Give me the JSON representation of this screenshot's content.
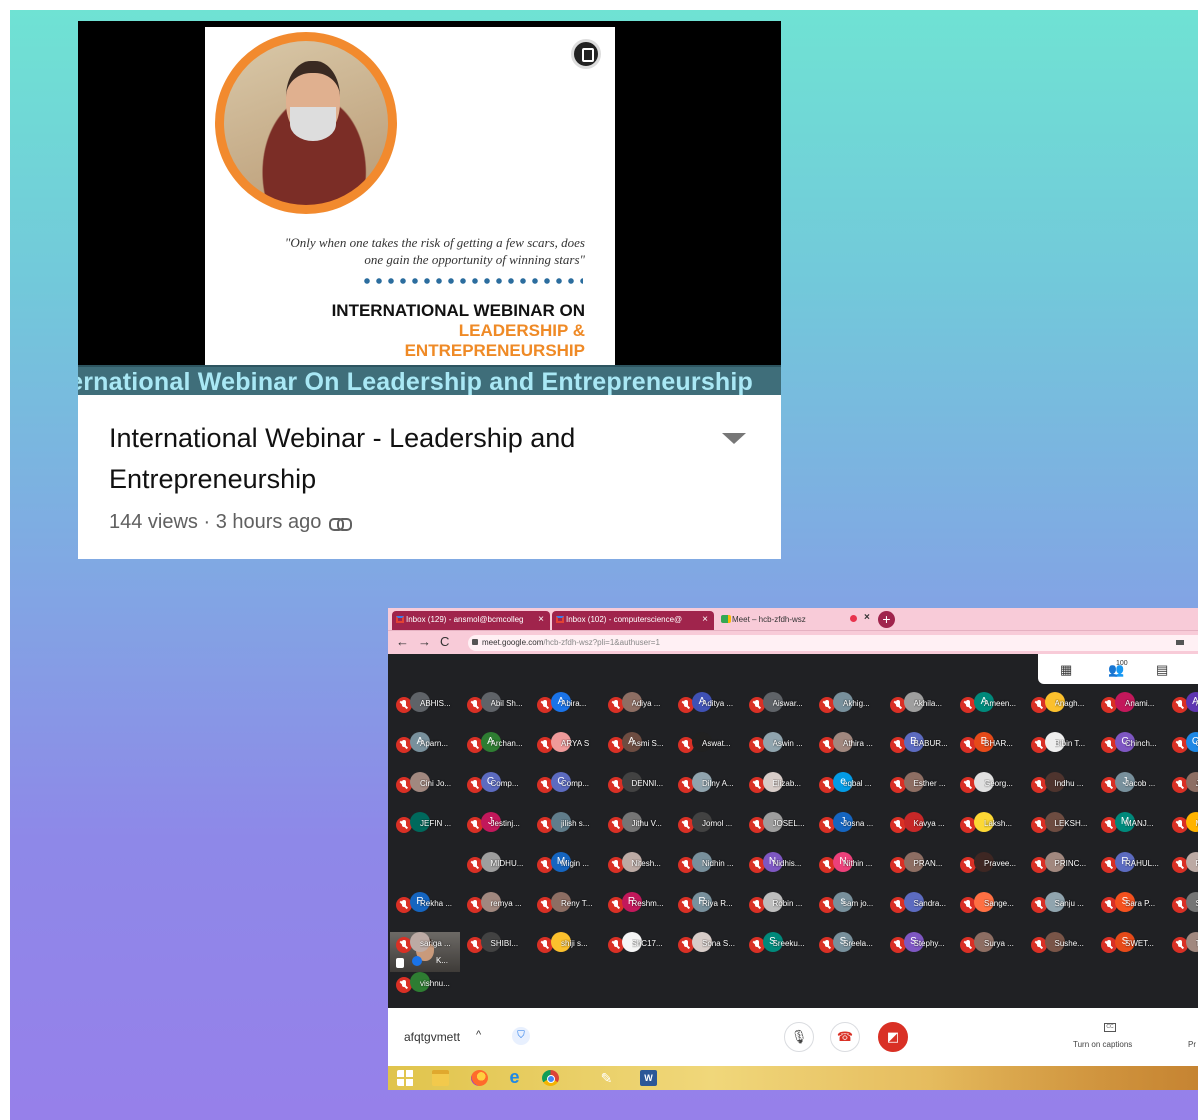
{
  "video": {
    "quote": "\"Only when one takes the risk of getting a few scars, does one gain the opportunity of winning stars\"",
    "poster_title_1": "INTERNATIONAL WEBINAR ON",
    "poster_title_2": "LEADERSHIP &",
    "poster_title_3": "ENTREPRENEURSHIP",
    "marquee": "International Webinar On Leadership and Entrepreneurship",
    "title": "International Webinar - Leadership and Entrepreneurship",
    "meta": "144 views · 3 hours ago"
  },
  "browser": {
    "tabs": [
      {
        "label": "Inbox (129) - ansmol@bcmcolleg"
      },
      {
        "label": "Inbox (102) - computerscience@"
      },
      {
        "label": "Meet – hcb-zfdh-wsz"
      }
    ],
    "url_host": "meet.google.com",
    "url_path": "/hcb-zfdh-wsz?pli=1&authuser=1"
  },
  "meet": {
    "participant_count": "100",
    "self_label": "K...",
    "participants": [
      {
        "name": "ABHIS...",
        "color": "#5f6368"
      },
      {
        "name": "Abil Sh...",
        "color": "#5f6368"
      },
      {
        "name": "Abira...",
        "color": "#1a73e8",
        "letter": "A"
      },
      {
        "name": "Adiya ...",
        "color": "#8d6e63"
      },
      {
        "name": "Aditya ...",
        "color": "#3f51b5",
        "letter": "A"
      },
      {
        "name": "Aiswar...",
        "color": "#5f6368"
      },
      {
        "name": "Akhig...",
        "color": "#78909c"
      },
      {
        "name": "Akhila...",
        "color": "#9e9e9e"
      },
      {
        "name": "Ameen...",
        "color": "#00897b",
        "letter": "A"
      },
      {
        "name": "Anagh...",
        "color": "#fbc02d"
      },
      {
        "name": "Anami...",
        "color": "#c2185b"
      },
      {
        "name": "Anitta ...",
        "color": "#5e35b1",
        "letter": "A"
      },
      {
        "name": "Aparn...",
        "color": "#78909c",
        "letter": "A"
      },
      {
        "name": "Archan...",
        "color": "#2e7d32",
        "letter": "A"
      },
      {
        "name": "ARYA S",
        "color": "#ef9a9a"
      },
      {
        "name": "Asmi S...",
        "color": "#6d4c41",
        "letter": "A"
      },
      {
        "name": "Aswat...",
        "color": "#212121"
      },
      {
        "name": "Aswin ...",
        "color": "#90a4ae"
      },
      {
        "name": "Athira ...",
        "color": "#a1887f"
      },
      {
        "name": "BABUR...",
        "color": "#5c6bc0",
        "letter": "B"
      },
      {
        "name": "BHAR...",
        "color": "#e64a19",
        "letter": "B"
      },
      {
        "name": "Bibin T...",
        "color": "#eeeeee"
      },
      {
        "name": "Chinch...",
        "color": "#7e57c2",
        "letter": "C"
      },
      {
        "name": "Christ...",
        "color": "#1e88e5",
        "letter": "C"
      },
      {
        "name": "Cini Jo...",
        "color": "#a1887f"
      },
      {
        "name": "Comp...",
        "color": "#5c6bc0",
        "letter": "C"
      },
      {
        "name": "Comp...",
        "color": "#5c6bc0",
        "letter": "C"
      },
      {
        "name": "DENNI...",
        "color": "#424242"
      },
      {
        "name": "Dilny A...",
        "color": "#90a4ae"
      },
      {
        "name": "Elizab...",
        "color": "#d7ccc8"
      },
      {
        "name": "eqbal ...",
        "color": "#039be5",
        "letter": "e"
      },
      {
        "name": "Esther ...",
        "color": "#8d6e63"
      },
      {
        "name": "Georg...",
        "color": "#e0e0e0"
      },
      {
        "name": "Indhu ...",
        "color": "#4e342e"
      },
      {
        "name": "Jacob ...",
        "color": "#78909c",
        "letter": "J"
      },
      {
        "name": "JEEVA...",
        "color": "#8d6e63"
      },
      {
        "name": "JEFIN ...",
        "color": "#00695c"
      },
      {
        "name": "Jestinj...",
        "color": "#c2185b",
        "letter": "J"
      },
      {
        "name": "jilish s...",
        "color": "#607d8b"
      },
      {
        "name": "Jithu V...",
        "color": "#757575"
      },
      {
        "name": "Jomol ...",
        "color": "#424242"
      },
      {
        "name": "JOSEL...",
        "color": "#9e9e9e"
      },
      {
        "name": "Josna ...",
        "color": "#1565c0",
        "letter": "J"
      },
      {
        "name": "Kavya ...",
        "color": "#c62828"
      },
      {
        "name": "Laksh...",
        "color": "#fdd835"
      },
      {
        "name": "LEKSH...",
        "color": "#6d4c41"
      },
      {
        "name": "MANJ...",
        "color": "#00897b",
        "letter": "M"
      },
      {
        "name": "Mariya ...",
        "color": "#ffb300"
      },
      {
        "name": "MIDHU...",
        "color": "#9e9e9e"
      },
      {
        "name": "Migin ...",
        "color": "#1565c0",
        "letter": "M"
      },
      {
        "name": "Nitesh...",
        "color": "#bcaaa4"
      },
      {
        "name": "Nidhin ...",
        "color": "#78909c"
      },
      {
        "name": "Nidhis...",
        "color": "#7e57c2",
        "letter": "N"
      },
      {
        "name": "Nithin ...",
        "color": "#ec407a",
        "letter": "N"
      },
      {
        "name": "PRAN...",
        "color": "#8d6e63"
      },
      {
        "name": "Pravee...",
        "color": "#3e2723"
      },
      {
        "name": "PRINC...",
        "color": "#a1887f"
      },
      {
        "name": "RAHUL...",
        "color": "#5c6bc0",
        "letter": "R"
      },
      {
        "name": "Rajesh...",
        "color": "#bcaaa4"
      },
      {
        "name": "Rekha ...",
        "color": "#1565c0",
        "letter": "R"
      },
      {
        "name": "remya ...",
        "color": "#a1887f"
      },
      {
        "name": "Reny T...",
        "color": "#8d6e63"
      },
      {
        "name": "Reshm...",
        "color": "#c2185b",
        "letter": "R"
      },
      {
        "name": "Riya R...",
        "color": "#78909c",
        "letter": "R"
      },
      {
        "name": "Robin ...",
        "color": "#bdbdbd"
      },
      {
        "name": "sam jo...",
        "color": "#78909c",
        "letter": "s"
      },
      {
        "name": "Sandra...",
        "color": "#5c6bc0"
      },
      {
        "name": "Sange...",
        "color": "#ff7043"
      },
      {
        "name": "Sanju ...",
        "color": "#90a4ae"
      },
      {
        "name": "Sara P...",
        "color": "#f4511e",
        "letter": "S"
      },
      {
        "name": "SARA...",
        "color": "#757575"
      },
      {
        "name": "sariga ...",
        "color": "#bcaaa4"
      },
      {
        "name": "SHIBI...",
        "color": "#424242"
      },
      {
        "name": "shiji s...",
        "color": "#fbc02d"
      },
      {
        "name": "ShC17...",
        "color": "#f5f5f5"
      },
      {
        "name": "Sona S...",
        "color": "#d7ccc8"
      },
      {
        "name": "Sreeku...",
        "color": "#00897b",
        "letter": "S"
      },
      {
        "name": "Sreela...",
        "color": "#78909c",
        "letter": "S"
      },
      {
        "name": "Stephy...",
        "color": "#7e57c2",
        "letter": "S"
      },
      {
        "name": "Surya ...",
        "color": "#8d6e63"
      },
      {
        "name": "Sushe...",
        "color": "#795548"
      },
      {
        "name": "SWET...",
        "color": "#e64a19",
        "letter": "S"
      },
      {
        "name": "Thara ...",
        "color": "#a1887f"
      },
      {
        "name": "vishnu...",
        "color": "#2e7d32"
      }
    ],
    "meeting_code": "afqtgvmett",
    "captions_label": "Turn on captions",
    "cc_text": "CC",
    "present_label": "Pr"
  }
}
